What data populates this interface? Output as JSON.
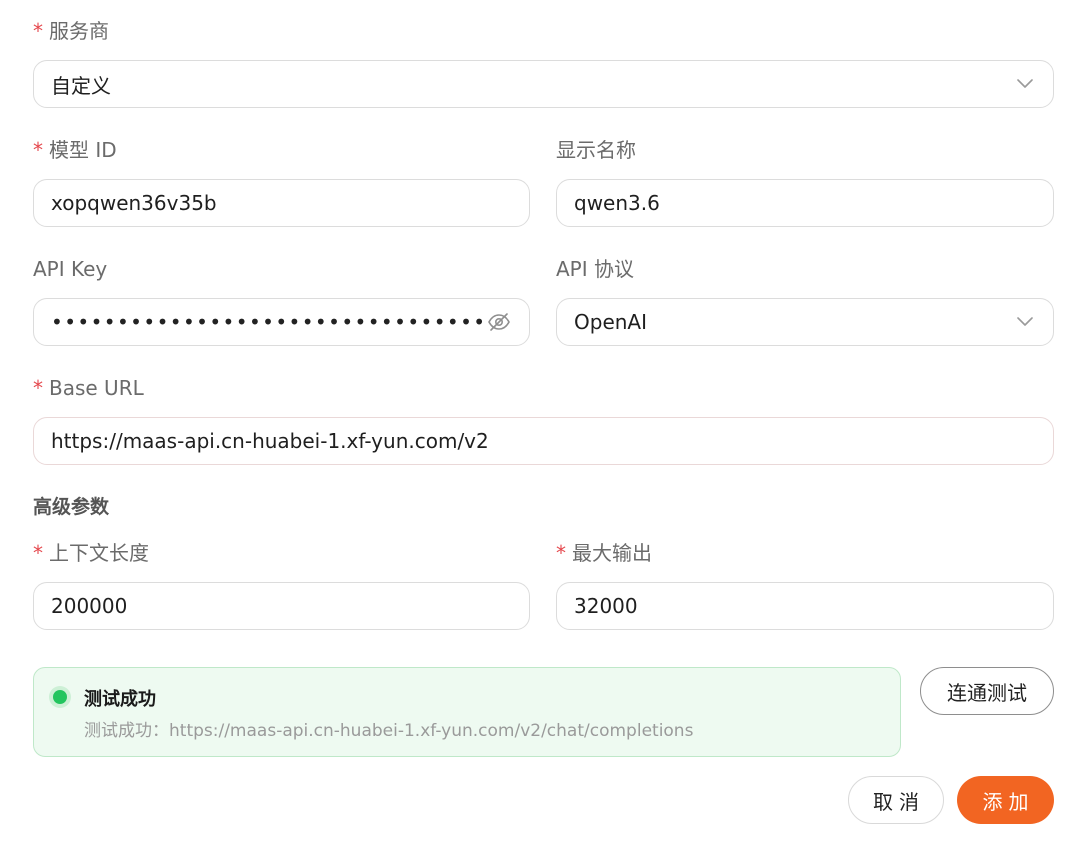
{
  "form": {
    "provider": {
      "label": "服务商",
      "value": "自定义"
    },
    "model_id": {
      "label": "模型 ID",
      "value": "xopqwen36v35b"
    },
    "display_name": {
      "label": "显示名称",
      "value": "qwen3.6"
    },
    "api_key": {
      "label": "API Key",
      "masked_value": "••••••••••••••••••••••••••••••••••••••••••••••"
    },
    "api_protocol": {
      "label": "API 协议",
      "value": "OpenAI"
    },
    "base_url": {
      "label": "Base URL",
      "value": "https://maas-api.cn-huabei-1.xf-yun.com/v2"
    }
  },
  "advanced": {
    "title": "高级参数",
    "context_length": {
      "label": "上下文长度",
      "value": "200000"
    },
    "max_output": {
      "label": "最大输出",
      "value": "32000"
    }
  },
  "test_result": {
    "title": "测试成功",
    "message": "测试成功：https://maas-api.cn-huabei-1.xf-yun.com/v2/chat/completions"
  },
  "buttons": {
    "test_connection": "连通测试",
    "cancel": "取消",
    "add": "添加"
  },
  "colors": {
    "accent": "#f26522",
    "success": "#22c55e",
    "required": "#e5484d"
  },
  "required_mark": "*"
}
